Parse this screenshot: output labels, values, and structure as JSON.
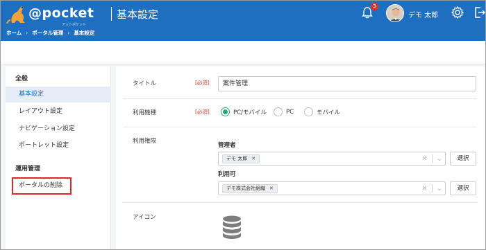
{
  "header": {
    "logo_text": "@pocket",
    "logo_sub": "アットポケット",
    "page_title": "基本設定",
    "notification_count": "3",
    "user_name": "デモ 太郎",
    "color": "#1f6fc1"
  },
  "breadcrumb": [
    "ホーム",
    "ポータル管理",
    "基本設定"
  ],
  "sidebar": {
    "section_general": "全般",
    "items_general": [
      "基本設定",
      "レイアウト設定",
      "ナビゲーション設定",
      "ポートレット設定"
    ],
    "section_operation": "運用管理",
    "items_operation": [
      "ポータルの削除"
    ]
  },
  "form": {
    "title_label": "タイトル",
    "title_required": "[必須]",
    "title_value": "案件管理",
    "device_label": "利用機種",
    "device_required": "[必須]",
    "device_options": [
      "PC/モバイル",
      "PC",
      "モバイル"
    ],
    "device_selected": "PC/モバイル",
    "permission_label": "利用権限",
    "admin_label": "管理者",
    "admin_chip": "デモ 太郎",
    "user_label": "利用可",
    "user_chip": "デモ株式会社組織",
    "select_button": "選択",
    "icon_label": "アイコン",
    "icon_name": "database-icon"
  }
}
